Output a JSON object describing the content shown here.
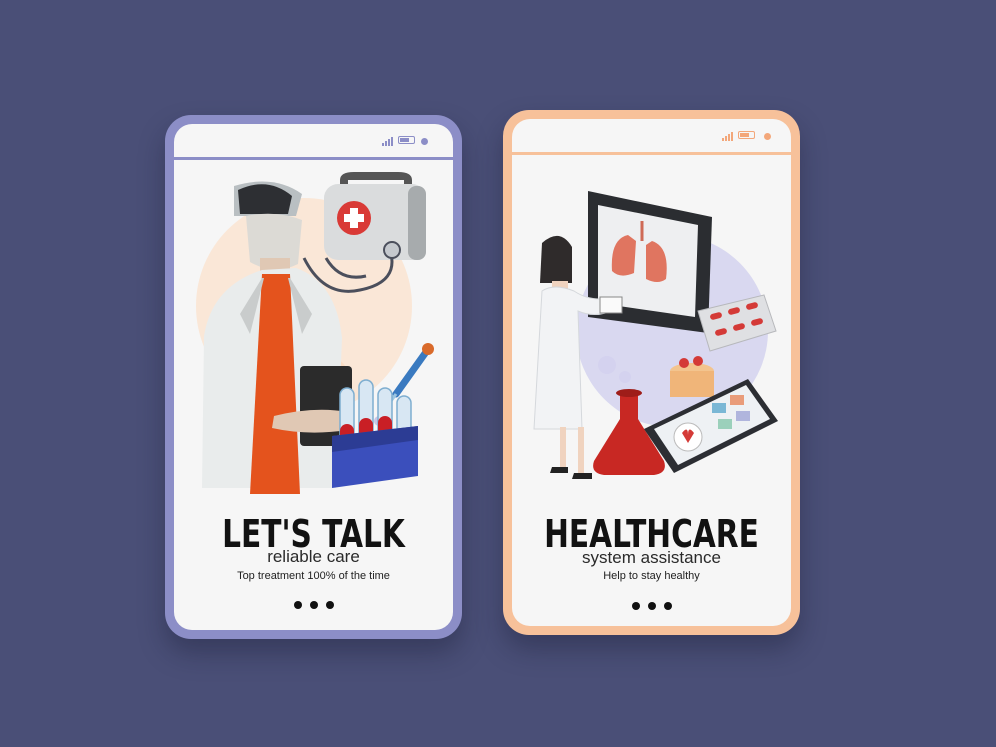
{
  "colors": {
    "background": "#4a4f77",
    "left_frame": "#8c8ec7",
    "right_frame": "#f7c19a",
    "screen": "#f6f6f6",
    "text": "#121212"
  },
  "screens": [
    {
      "headline": "LET'S TALK",
      "subtitle": "reliable care",
      "caption": "Top treatment 100% of the time",
      "illustration_icons": [
        "doctor-icon",
        "first-aid-kit-icon",
        "stethoscope-icon",
        "test-tubes-icon",
        "dropper-icon"
      ],
      "page_dots": 3
    },
    {
      "headline": "HEALTHCARE",
      "subtitle": "system assistance",
      "caption": "Help to stay healthy",
      "illustration_icons": [
        "lungs-xray-monitor-icon",
        "doctor-icon",
        "pill-blister-icon",
        "flask-icon",
        "pill-jar-icon",
        "tablet-heart-icon"
      ],
      "page_dots": 3
    }
  ]
}
